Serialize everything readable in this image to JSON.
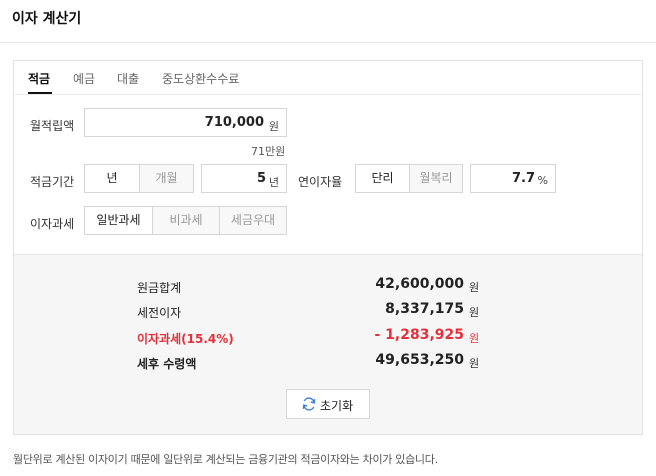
{
  "header": {
    "title": "이자 계산기"
  },
  "tabs": [
    {
      "label": "적금",
      "active": true
    },
    {
      "label": "예금",
      "active": false
    },
    {
      "label": "대출",
      "active": false
    },
    {
      "label": "중도상환수수료",
      "active": false
    }
  ],
  "form": {
    "monthly": {
      "label": "월적립액",
      "value": "710,000",
      "unit": "원",
      "hint": "71만원"
    },
    "period": {
      "label": "적금기간",
      "unit_options": [
        {
          "label": "년",
          "selected": true
        },
        {
          "label": "개월",
          "selected": false
        }
      ],
      "value": "5",
      "value_unit": "년"
    },
    "rate": {
      "label": "연이자율",
      "type_options": [
        {
          "label": "단리",
          "selected": true
        },
        {
          "label": "월복리",
          "selected": false
        }
      ],
      "value": "7.7",
      "unit": "%"
    },
    "tax": {
      "label": "이자과세",
      "options": [
        {
          "label": "일반과세",
          "selected": true
        },
        {
          "label": "비과세",
          "selected": false
        },
        {
          "label": "세금우대",
          "selected": false
        }
      ]
    }
  },
  "result": {
    "rows": [
      {
        "label": "원금합계",
        "value": "42,600,000",
        "unit": "원",
        "style": "normal"
      },
      {
        "label": "세전이자",
        "value": "8,337,175",
        "unit": "원",
        "style": "normal"
      },
      {
        "label": "이자과세(15.4%)",
        "value": "- 1,283,925",
        "unit": "원",
        "style": "red"
      },
      {
        "label": "세후 수령액",
        "value": "49,653,250",
        "unit": "원",
        "style": "bold"
      }
    ],
    "reset_label": "초기화"
  },
  "footnote": "월단위로 계산된 이자이기 때문에 일단위로 계산되는 금융기관의 적금이자와는 차이가 있습니다.",
  "colors": {
    "accent_red": "#e5303a",
    "reset_icon": "#3b7bd9"
  }
}
